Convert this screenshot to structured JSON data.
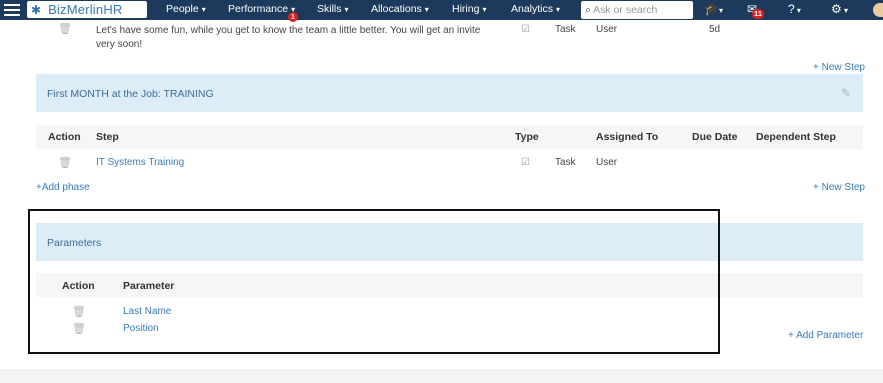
{
  "nav": {
    "logo_text": "BizMerlinHR",
    "items": [
      {
        "label": "People",
        "caret": "▾"
      },
      {
        "label": "Performance",
        "caret": "▾",
        "badge": "1"
      },
      {
        "label": "Skills",
        "caret": "▾"
      },
      {
        "label": "Allocations",
        "caret": "▾"
      },
      {
        "label": "Hiring",
        "caret": "▾"
      },
      {
        "label": "Analytics",
        "caret": "▾"
      }
    ],
    "search_placeholder": "Ask or search",
    "mail_badge": "11",
    "icons": [
      "hamburger-icon",
      "bee-logo-icon",
      "graduation-cap-icon",
      "mail-icon",
      "help-icon",
      "gear-icon",
      "user-avatar-icon"
    ]
  },
  "top_row": {
    "text_line1": "Let's have some fun, while you get to know the team a little better. You will get an invite",
    "text_line2": "very soon!",
    "type": "Task",
    "assigned": "User",
    "due": "5d"
  },
  "new_step_1": "+ New Step",
  "phase": {
    "title": "First MONTH at the Job: TRAINING",
    "columns": [
      "Action",
      "Step",
      "Type",
      "Assigned To",
      "Due Date",
      "Dependent Step"
    ],
    "rows": [
      {
        "step": "IT Systems Training",
        "type": "Task",
        "assigned": "User"
      }
    ]
  },
  "add_phase": "+Add phase",
  "new_step_2": "+ New Step",
  "parameters": {
    "title": "Parameters",
    "columns": [
      "Action",
      "Parameter"
    ],
    "rows": [
      {
        "name": "Last Name"
      },
      {
        "name": "Position"
      }
    ],
    "add_label": "+ Add Parameter"
  }
}
